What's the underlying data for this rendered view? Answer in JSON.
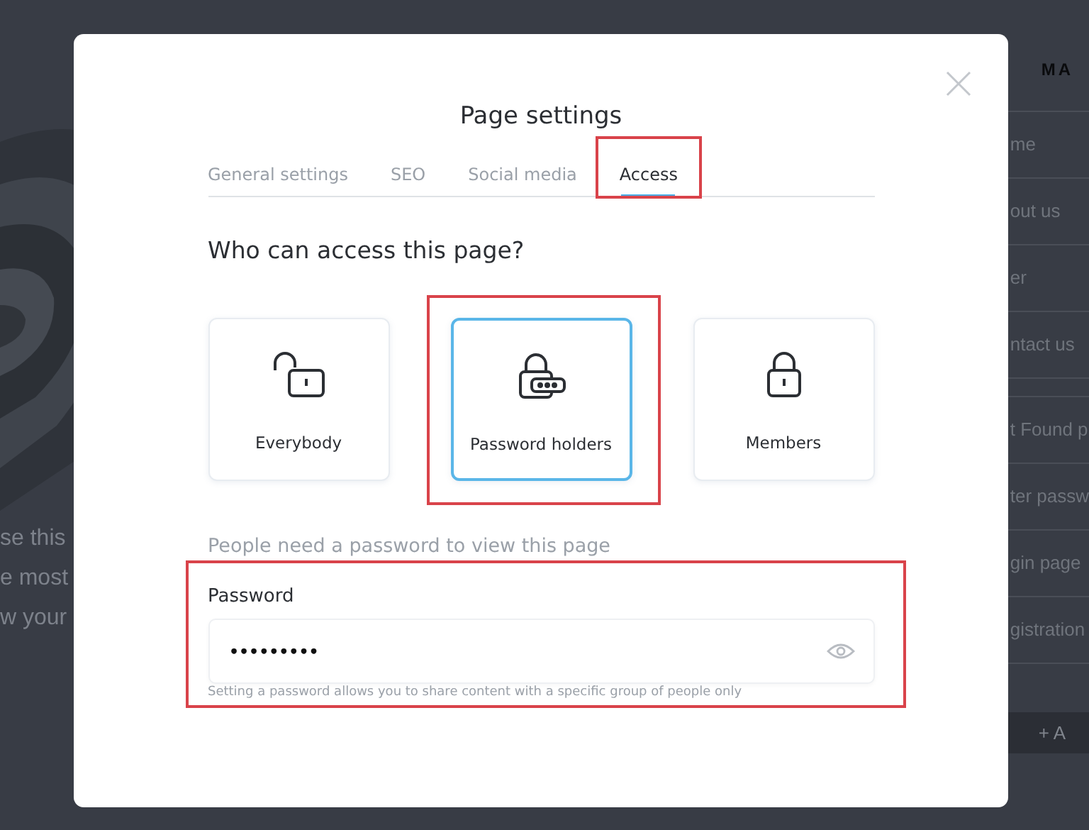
{
  "background": {
    "left_texts": [
      "se this",
      "e most",
      "w your"
    ],
    "sidebar": {
      "header": "MA",
      "groups": [
        [
          "me",
          "out us",
          "er",
          "ntact us"
        ],
        [
          "t Found p",
          "ter passw",
          "gin page",
          "gistration"
        ]
      ],
      "button": "+ A"
    }
  },
  "modal": {
    "title": "Page settings",
    "tabs": [
      {
        "label": "General settings",
        "selected": false,
        "highlighted": false
      },
      {
        "label": "SEO",
        "selected": false,
        "highlighted": false
      },
      {
        "label": "Social media",
        "selected": false,
        "highlighted": false
      },
      {
        "label": "Access",
        "selected": true,
        "highlighted": true
      }
    ],
    "question": "Who can access this page?",
    "options": [
      {
        "kind": "unlocked",
        "label": "Everybody",
        "selected": false,
        "highlighted": false
      },
      {
        "kind": "password",
        "label": "Password holders",
        "selected": true,
        "highlighted": true
      },
      {
        "kind": "locked",
        "label": "Members",
        "selected": false,
        "highlighted": false
      }
    ],
    "hint": "People need a password to view this page",
    "password": {
      "label": "Password",
      "value": "•••••••••",
      "helper": "Setting a password allows you to share content with a specific group of people only",
      "highlighted": true
    }
  }
}
